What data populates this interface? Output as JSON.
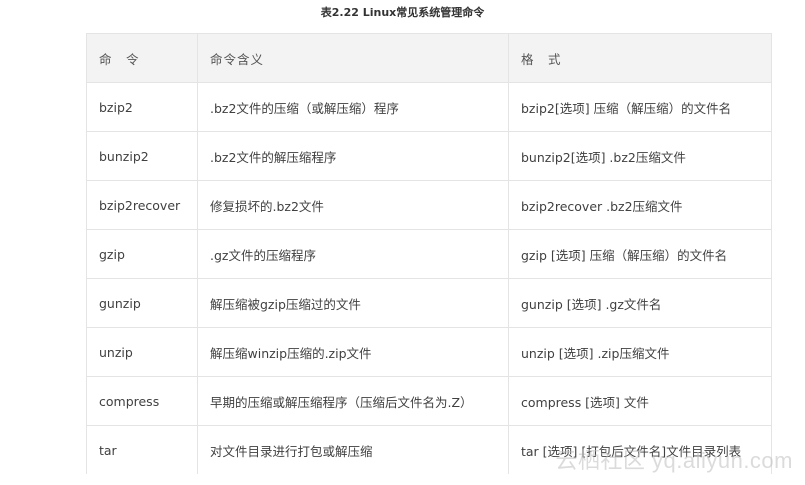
{
  "caption": "表2.22 Linux常见系统管理命令",
  "headers": [
    "命　令",
    "命令含义",
    "格　式"
  ],
  "rows": [
    {
      "command": "bzip2",
      "meaning": ".bz2文件的压缩（或解压缩）程序",
      "format": "bzip2[选项] 压缩（解压缩）的文件名"
    },
    {
      "command": "bunzip2",
      "meaning": ".bz2文件的解压缩程序",
      "format": "bunzip2[选项] .bz2压缩文件"
    },
    {
      "command": "bzip2recover",
      "meaning": "修复损坏的.bz2文件",
      "format": "bzip2recover .bz2压缩文件"
    },
    {
      "command": "gzip",
      "meaning": ".gz文件的压缩程序",
      "format": "gzip [选项] 压缩（解压缩）的文件名"
    },
    {
      "command": "gunzip",
      "meaning": "解压缩被gzip压缩过的文件",
      "format": "gunzip [选项] .gz文件名"
    },
    {
      "command": "unzip",
      "meaning": "解压缩winzip压缩的.zip文件",
      "format": "unzip [选项] .zip压缩文件"
    },
    {
      "command": "compress",
      "meaning": "早期的压缩或解压缩程序（压缩后文件名为.Z）",
      "format": "compress [选项] 文件"
    },
    {
      "command": "tar",
      "meaning": "对文件目录进行打包或解压缩",
      "format": "tar [选项] [打包后文件名]文件目录列表"
    }
  ],
  "watermark": "云栖社区 yq.aliyun.com"
}
